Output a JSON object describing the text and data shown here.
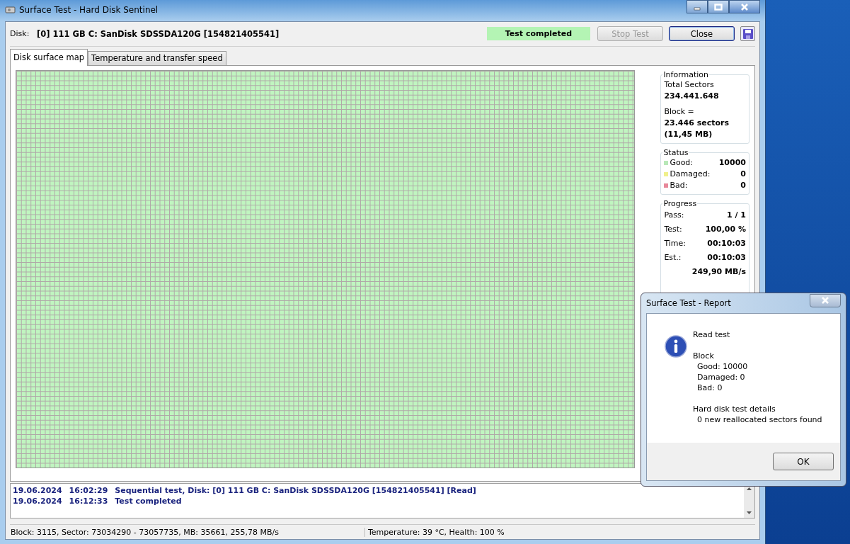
{
  "window": {
    "title": "Surface Test - Hard Disk Sentinel"
  },
  "disk": {
    "label": "Disk:",
    "value": "[0] 111 GB C: SanDisk SDSSDA120G [154821405541]"
  },
  "status_indicator": "Test completed",
  "buttons": [
    {
      "label": "Stop Test",
      "disabled": true,
      "default": false
    },
    {
      "label": "Close",
      "disabled": false,
      "default": true
    }
  ],
  "tabs": [
    {
      "label": "Disk surface map",
      "selected": true
    },
    {
      "label": "Temperature and transfer speed",
      "selected": false
    }
  ],
  "information": {
    "title": "Information",
    "rows": [
      {
        "label": "Total Sectors",
        "values": [
          "234.441.648"
        ]
      },
      {
        "label": "Block =",
        "values": [
          "23.446 sectors",
          "(11,45 MB)"
        ]
      }
    ]
  },
  "status": {
    "title": "Status",
    "rows": [
      {
        "label": "Good:",
        "value": "10000",
        "color": "#b8e8b8"
      },
      {
        "label": "Damaged:",
        "value": "0",
        "color": "#f0f08c"
      },
      {
        "label": "Bad:",
        "value": "0",
        "color": "#e8889a"
      }
    ]
  },
  "progress": {
    "title": "Progress",
    "rows": [
      {
        "label": "Pass:",
        "value": "1 / 1"
      },
      {
        "label": "Test:",
        "value": "100,00 %"
      },
      {
        "label": "Time:",
        "value": "00:10:03"
      },
      {
        "label": "Est.:",
        "value": "00:10:03"
      },
      {
        "value": "249,90 MB/s"
      }
    ]
  },
  "log": [
    {
      "date": "19.06.2024",
      "time": "16:02:29",
      "text": "Sequential test, Disk: [0] 111 GB C: SanDisk SDSSDA120G [154821405541] [Read]"
    },
    {
      "date": "19.06.2024",
      "time": "16:12:33",
      "text": "Test completed"
    }
  ],
  "status_bar": [
    "Block: 3115, Sector: 73034290 - 73057735, MB: 35661, 255,78 MB/s",
    "Temperature: 39  °C,  Health: 100 %"
  ],
  "dialog": {
    "title": "Surface Test - Report",
    "sections": [
      {
        "heading": "Read test"
      },
      {
        "heading": "Block",
        "lines": [
          "Good: 10000",
          "Damaged: 0",
          "Bad: 0"
        ]
      },
      {
        "heading": "Hard disk test details",
        "lines": [
          "0 new reallocated sectors found"
        ]
      }
    ],
    "button": "OK"
  }
}
